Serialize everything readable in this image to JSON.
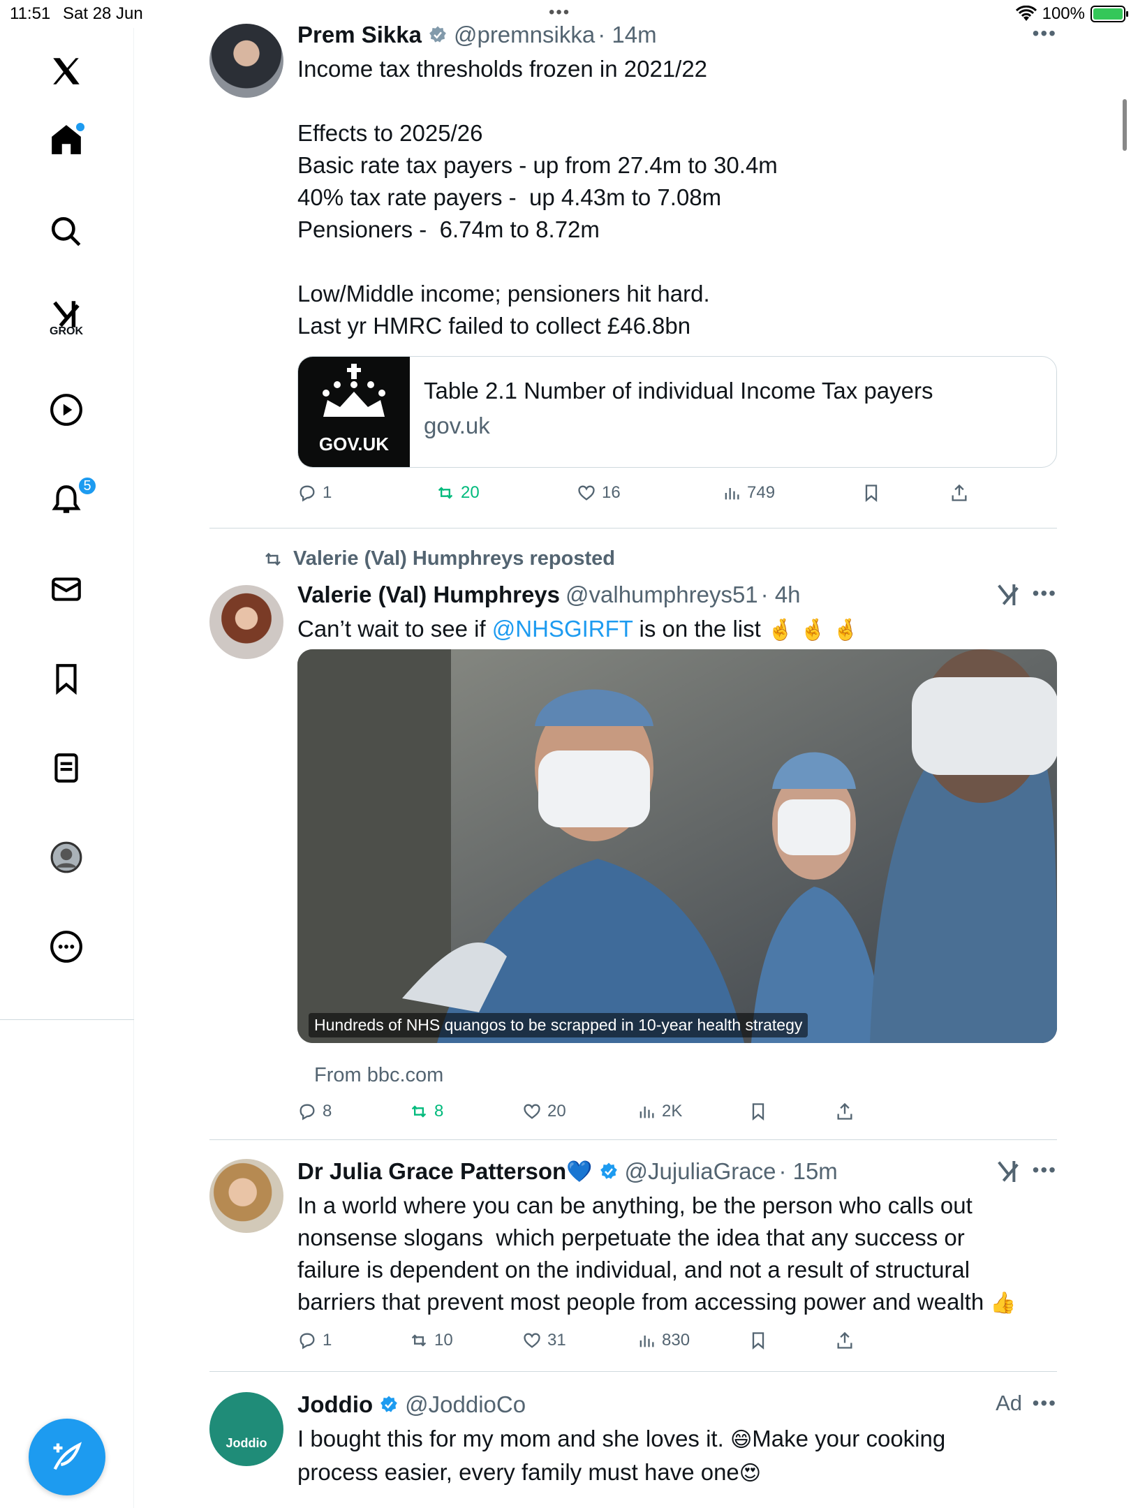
{
  "status_bar": {
    "time": "11:51",
    "date": "Sat 28 Jun",
    "battery": "100%"
  },
  "sidebar": {
    "grok_label": "GROK",
    "notifications_count": "5"
  },
  "tweets": [
    {
      "name": "Prem Sikka",
      "handle": "@premnsikka",
      "time": "· 14m",
      "text": "Income tax thresholds frozen in 2021/22\n\nEffects to 2025/26\nBasic rate tax payers - up from 27.4m to 30.4m\n40% tax rate payers -  up 4.43m to 7.08m\nPensioners -  6.74m to 8.72m\n\nLow/Middle income; pensioners hit hard.\nLast yr HMRC failed to collect £46.8bn",
      "card": {
        "thumb_text": "GOV.UK",
        "title": "Table 2.1 Number of individual Income Tax payers",
        "domain": "gov.uk"
      },
      "replies": "1",
      "reposts": "20",
      "likes": "16",
      "views": "749"
    },
    {
      "repost_by": "Valerie (Val) Humphreys reposted",
      "name": "Valerie (Val) Humphreys",
      "handle": "@valhumphreys51",
      "time": "· 4h",
      "text_before": "Can’t wait to see if ",
      "mention": "@NHSGIRFT",
      "text_after": " is on the list ",
      "emoji": "🤞 🤞 🤞",
      "media_caption": "Hundreds of NHS quangos to be scrapped in 10-year health strategy",
      "from": "From bbc.com",
      "replies": "8",
      "reposts": "8",
      "likes": "20",
      "views": "2K"
    },
    {
      "name": "Dr Julia Grace Patterson",
      "name_emoji": "💙",
      "handle": "@JujuliaGrace",
      "time": "· 15m",
      "text": "In a world where you can be anything, be the person who calls out\nnonsense slogans  which perpetuate the idea that any success or\nfailure is dependent on the individual, and not a result of structural\nbarriers that prevent most people from accessing power and wealth ",
      "text_emoji": "👍",
      "replies": "1",
      "reposts": "10",
      "likes": "31",
      "views": "830"
    },
    {
      "name": "Joddio",
      "handle": "@JoddioCo",
      "ad_label": "Ad",
      "avatar_text": "Joddio",
      "text_1": "I bought this for my mom and she loves it. ",
      "emoji_1": "😄",
      "text_2": "Make your cooking",
      "text_3": "process easier, every family must have one",
      "emoji_2": "😍"
    }
  ],
  "colors": {
    "accent": "#1d9bf0",
    "repost_green": "#00ba7c",
    "muted": "#536471"
  }
}
